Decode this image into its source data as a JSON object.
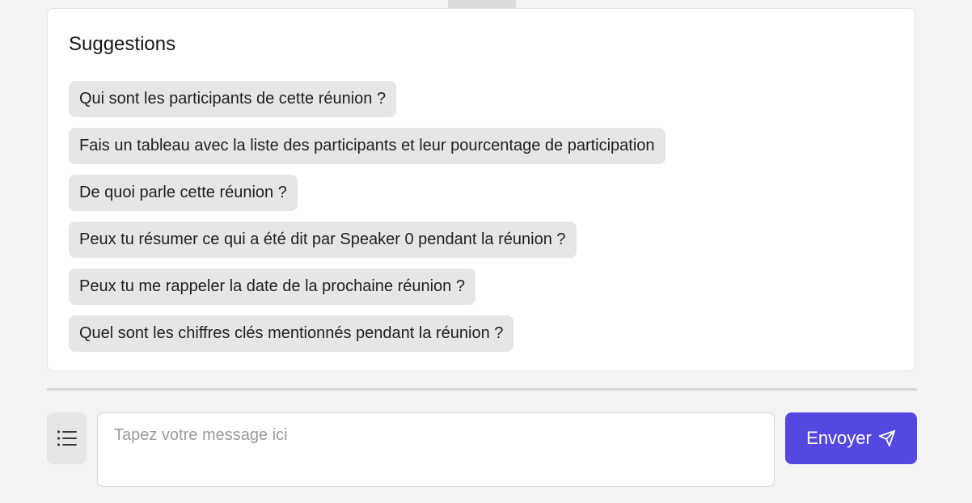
{
  "suggestions": {
    "title": "Suggestions",
    "items": [
      {
        "label": "Qui sont les participants de cette réunion ?"
      },
      {
        "label": "Fais un tableau avec la liste des participants et leur pourcentage de participation"
      },
      {
        "label": "De quoi parle cette réunion ?"
      },
      {
        "label": "Peux tu résumer ce qui a été dit par Speaker 0 pendant la réunion ?"
      },
      {
        "label": "Peux tu me rappeler la date de la prochaine réunion ?"
      },
      {
        "label": "Quel sont les chiffres clés mentionnés pendant la réunion ?"
      }
    ]
  },
  "composer": {
    "list_icon": "list-icon",
    "input_value": "",
    "input_placeholder": "Tapez votre message ici",
    "send_label": "Envoyer",
    "send_icon": "send-icon"
  },
  "colors": {
    "accent": "#5548e0",
    "chip_background": "#e6e6e6",
    "page_background": "#f3f3f3",
    "card_background": "#ffffff"
  }
}
